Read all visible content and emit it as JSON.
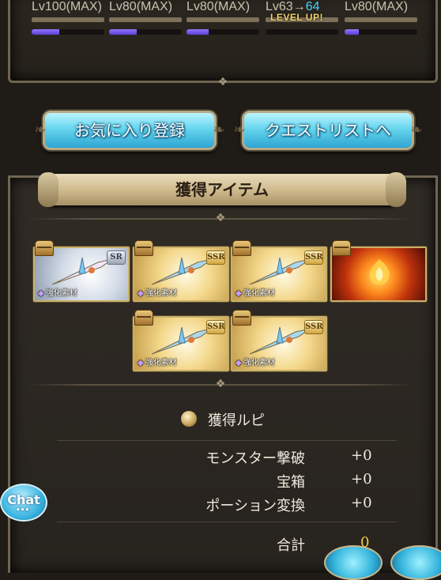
{
  "party": {
    "members": [
      {
        "level": "Lv100(MAX)",
        "level_to": "",
        "level_up": "",
        "exp_pct": 0.38
      },
      {
        "level": "Lv80(MAX)",
        "level_to": "",
        "level_up": "",
        "exp_pct": 0.38
      },
      {
        "level": "Lv80(MAX)",
        "level_to": "",
        "level_up": "",
        "exp_pct": 0.3
      },
      {
        "level": "Lv63→",
        "level_to": "64",
        "level_up": "LEVEL UP!",
        "exp_pct": 0.0
      },
      {
        "level": "Lv80(MAX)",
        "level_to": "",
        "level_up": "",
        "exp_pct": 0.2
      }
    ]
  },
  "buttons": {
    "favorite": "お気に入り登録",
    "quest_list": "クエストリストへ"
  },
  "items_section": {
    "title": "獲得アイテム",
    "items": [
      {
        "rarity": "SR",
        "tag": "強化素材",
        "style": "silver"
      },
      {
        "rarity": "SSR",
        "tag": "強化素材",
        "style": "gold"
      },
      {
        "rarity": "SSR",
        "tag": "強化素材",
        "style": "gold"
      },
      {
        "rarity": "",
        "tag": "",
        "style": "fire"
      },
      {
        "rarity": "SSR",
        "tag": "強化素材",
        "style": "gold"
      },
      {
        "rarity": "SSR",
        "tag": "強化素材",
        "style": "gold"
      }
    ]
  },
  "rupi": {
    "title": "獲得ルピ",
    "rows": [
      {
        "label": "モンスター撃破",
        "value": "+0"
      },
      {
        "label": "宝箱",
        "value": "+0"
      },
      {
        "label": "ポーション変換",
        "value": "+0"
      }
    ],
    "total_label": "合計",
    "total_value": "0"
  },
  "chat": {
    "label": "Chat"
  },
  "colors": {
    "accent_blue": "#66d6ee",
    "gold": "#f0cc3a",
    "level_to": "#3fd2ff"
  }
}
